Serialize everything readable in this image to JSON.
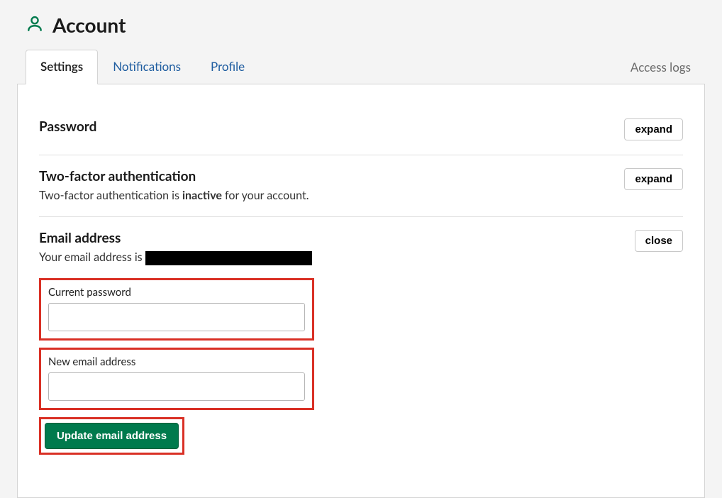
{
  "page": {
    "title": "Account"
  },
  "tabs": {
    "settings": "Settings",
    "notifications": "Notifications",
    "profile": "Profile",
    "access_logs": "Access logs"
  },
  "sections": {
    "password": {
      "title": "Password",
      "action": "expand"
    },
    "twofa": {
      "title": "Two-factor authentication",
      "sub_pre": "Two-factor authentication is ",
      "sub_status": "inactive",
      "sub_post": " for your account.",
      "action": "expand"
    },
    "email": {
      "title": "Email address",
      "sub_pre": "Your email address is ",
      "action": "close",
      "field_current_password": "Current password",
      "field_new_email": "New email address",
      "submit": "Update email address"
    }
  }
}
